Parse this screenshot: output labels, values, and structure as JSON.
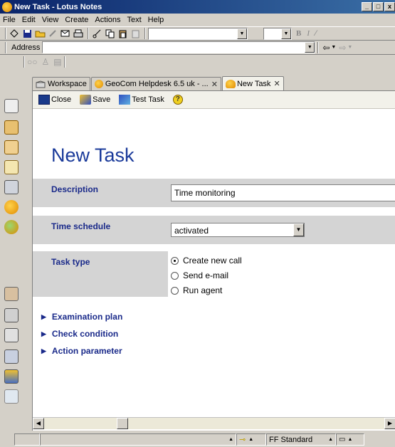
{
  "window": {
    "title": "New Task - Lotus Notes"
  },
  "menu": [
    "File",
    "Edit",
    "View",
    "Create",
    "Actions",
    "Text",
    "Help"
  ],
  "address_bar": {
    "label": "Address",
    "value": ""
  },
  "tabs": [
    {
      "label": "Workspace",
      "closable": false,
      "active": false
    },
    {
      "label": "GeoCom Helpdesk 6.5 uk - ...",
      "closable": true,
      "active": false
    },
    {
      "label": "New Task",
      "closable": true,
      "active": true
    }
  ],
  "actions": [
    {
      "label": "Close",
      "icon": "close-doc-icon"
    },
    {
      "label": "Save",
      "icon": "save-icon"
    },
    {
      "label": "Test Task",
      "icon": "test-icon"
    },
    {
      "label": "",
      "icon": "help-icon"
    }
  ],
  "form": {
    "title": "New Task",
    "description_label": "Description",
    "description_value": "Time monitoring",
    "time_schedule_label": "Time schedule",
    "time_schedule_value": "activated",
    "task_type_label": "Task type",
    "task_type_options": [
      {
        "label": "Create new call",
        "selected": true
      },
      {
        "label": "Send e-mail",
        "selected": false
      },
      {
        "label": "Run agent",
        "selected": false
      }
    ],
    "sections": [
      "Examination plan",
      "Check condition",
      "Action parameter"
    ]
  },
  "statusbar": {
    "font": "FF Standard"
  },
  "colors": {
    "title_blue": "#1a3a9a",
    "label_bg": "#d4d4d4",
    "titlebar_start": "#0a246a"
  }
}
